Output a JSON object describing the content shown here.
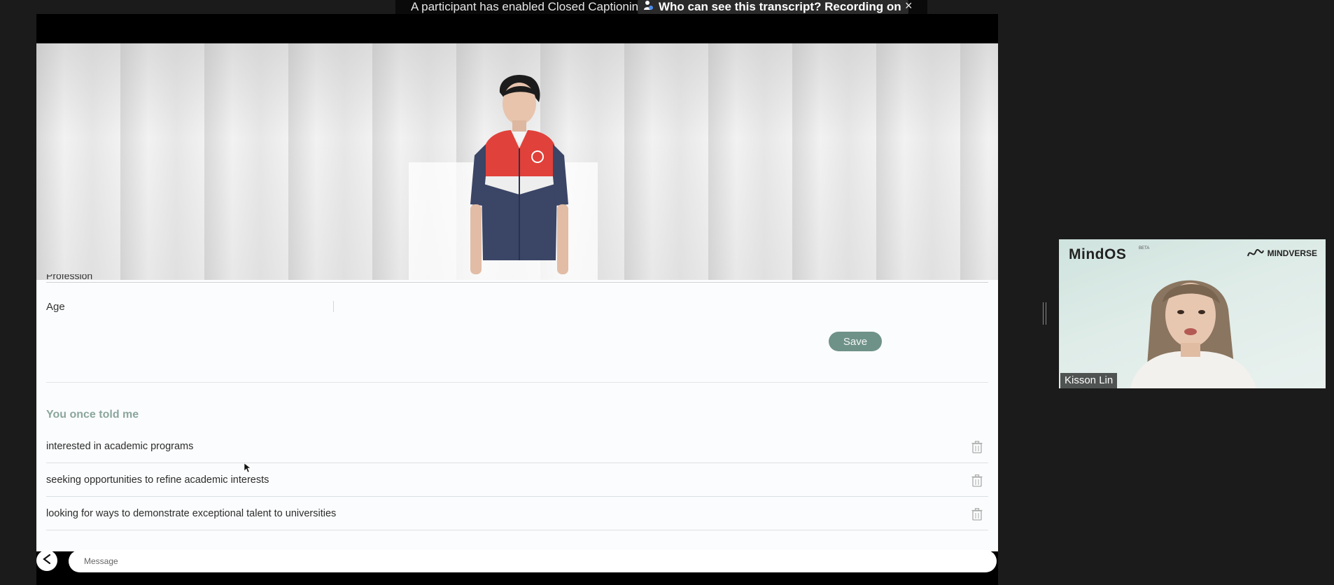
{
  "banner": {
    "cc_text": "A participant has enabled Closed Captioning",
    "transcript_text": "Who can see this transcript? Recording on",
    "close_glyph": "×",
    "transcript_icon": "person-info-icon"
  },
  "profile": {
    "partial_label": "Profession",
    "age_label": "Age",
    "save_label": "Save"
  },
  "memories": {
    "title": "You once told me",
    "items": [
      "interested in academic programs",
      "seeking opportunities to refine academic interests",
      "looking for ways to demonstrate exceptional talent to universities"
    ]
  },
  "composer": {
    "placeholder": "Message",
    "back_icon": "chevron-left-icon"
  },
  "participant": {
    "name": "Kisson Lin",
    "brand_left": "MindOS",
    "brand_left_badge": "BETA",
    "brand_right": "MINDVERSE"
  },
  "colors": {
    "accent_green": "#6f9288",
    "section_title": "#8aa69d",
    "jacket_red": "#e0413a",
    "jacket_navy": "#3b4566"
  }
}
